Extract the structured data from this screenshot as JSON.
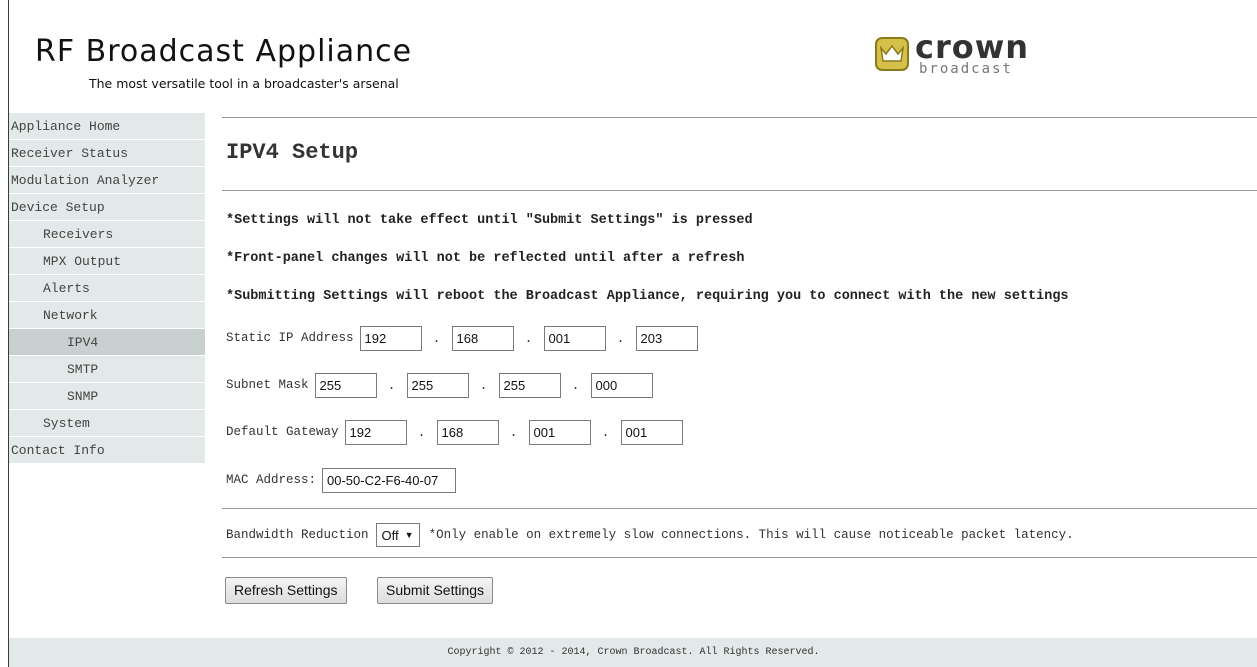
{
  "header": {
    "title": "RF Broadcast Appliance",
    "tagline": "The most versatile tool in a broadcaster's arsenal",
    "logo": {
      "word": "crown",
      "sub": "broadcast",
      "accent_color": "#d4c04a",
      "icon": "crown-icon"
    }
  },
  "sidebar": {
    "items": [
      {
        "label": "Appliance Home"
      },
      {
        "label": "Receiver Status"
      },
      {
        "label": "Modulation Analyzer"
      },
      {
        "label": "Device Setup"
      },
      {
        "label": "Receivers"
      },
      {
        "label": "MPX Output"
      },
      {
        "label": "Alerts"
      },
      {
        "label": "Network"
      },
      {
        "label": "IPV4"
      },
      {
        "label": "SMTP"
      },
      {
        "label": "SNMP"
      },
      {
        "label": "System"
      },
      {
        "label": "Contact Info"
      }
    ],
    "active": "IPV4"
  },
  "main": {
    "title": "IPV4 Setup",
    "notes": [
      "*Settings will not take effect until \"Submit Settings\" is pressed",
      "*Front-panel changes will not be reflected until after a refresh",
      "*Submitting Settings will reboot the Broadcast Appliance, requiring you to connect with the new settings"
    ],
    "static_ip": {
      "label": "Static IP Address",
      "octets": [
        "192",
        "168",
        "001",
        "203"
      ]
    },
    "subnet": {
      "label": "Subnet Mask",
      "octets": [
        "255",
        "255",
        "255",
        "000"
      ]
    },
    "gateway": {
      "label": "Default Gateway",
      "octets": [
        "192",
        "168",
        "001",
        "001"
      ]
    },
    "mac": {
      "label": "MAC Address:",
      "value": "00-50-C2-F6-40-07"
    },
    "separator": ".",
    "bandwidth": {
      "label": "Bandwidth Reduction",
      "selected": "Off",
      "note": "*Only enable on extremely slow connections. This will cause noticeable packet latency."
    },
    "buttons": {
      "refresh": "Refresh Settings",
      "submit": "Submit Settings"
    }
  },
  "footer": {
    "copyright": "Copyright © 2012 - 2014, Crown Broadcast. All Rights Reserved."
  }
}
